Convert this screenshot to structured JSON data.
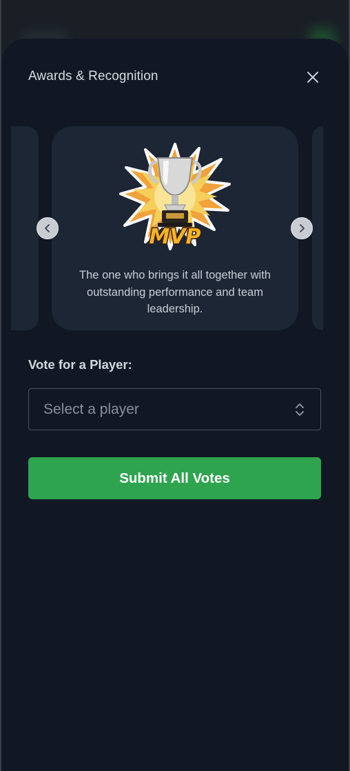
{
  "modal": {
    "title": "Awards & Recognition"
  },
  "award": {
    "badge_text": "MVP",
    "description": "The one who brings it all together with outstanding performance and team leadership."
  },
  "vote": {
    "label": "Vote for a Player:",
    "select_placeholder": "Select a player"
  },
  "actions": {
    "submit_label": "Submit All Votes"
  },
  "icons": {
    "close": "close-icon",
    "prev": "chevron-left-icon",
    "next": "chevron-right-icon",
    "select": "chevron-up-down-icon",
    "trophy": "trophy-icon"
  },
  "colors": {
    "sheet_background": "#111823",
    "card_background": "#1c2634",
    "submit_green": "#2ea44f"
  }
}
